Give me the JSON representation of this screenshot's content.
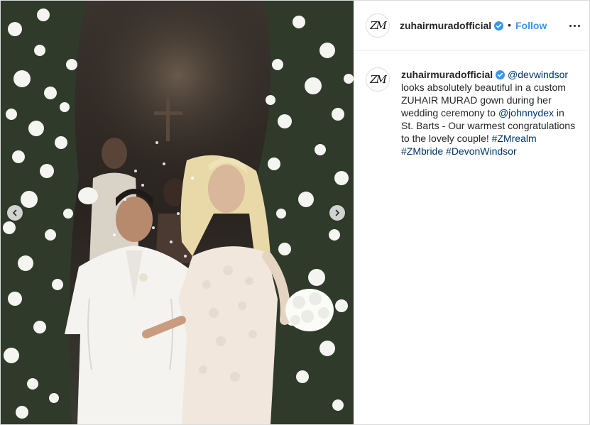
{
  "post": {
    "username": "zuhairmuradofficial",
    "verified": true,
    "separator": "•",
    "follow_label": "Follow",
    "avatar_initials": "ZM",
    "more_icon": "more-options-icon"
  },
  "caption": {
    "username": "zuhairmuradofficial",
    "mention_1": "@devwindsor",
    "text_1": " looks absolutely beautiful in a custom ZUHAIR MURAD gown during her wedding ceremony to ",
    "mention_2": "@johnnydex",
    "text_2": " in St. Barts - Our warmest congratulations to the lovely couple! ",
    "hashtags": [
      "#ZMrealm",
      "#ZMbride",
      "#DevonWindsor"
    ]
  },
  "photo": {
    "prev_icon": "chevron-left-icon",
    "next_icon": "chevron-right-icon"
  },
  "colors": {
    "link": "#003569",
    "follow": "#3897f0",
    "verified": "#3897f0",
    "text": "#262626",
    "border": "#dbdbdb"
  }
}
